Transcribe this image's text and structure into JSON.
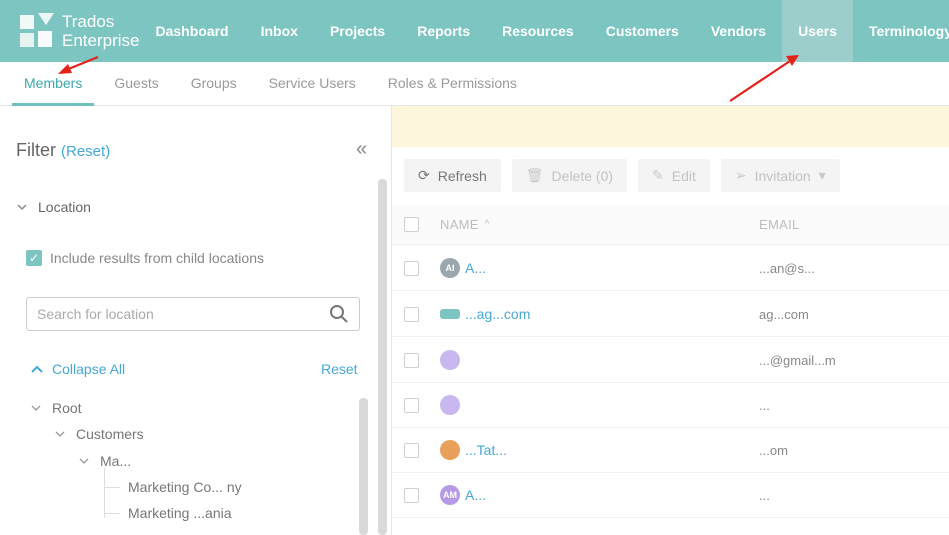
{
  "app": {
    "brand_line1": "Trados",
    "brand_line2": "Enterprise"
  },
  "nav": {
    "items": [
      {
        "label": "Dashboard"
      },
      {
        "label": "Inbox"
      },
      {
        "label": "Projects"
      },
      {
        "label": "Reports"
      },
      {
        "label": "Resources"
      },
      {
        "label": "Customers"
      },
      {
        "label": "Vendors"
      },
      {
        "label": "Users",
        "active": true
      },
      {
        "label": "Terminology"
      }
    ]
  },
  "subtabs": [
    {
      "label": "Members",
      "active": true
    },
    {
      "label": "Guests"
    },
    {
      "label": "Groups"
    },
    {
      "label": "Service Users"
    },
    {
      "label": "Roles & Permissions"
    }
  ],
  "filter": {
    "title": "Filter",
    "reset_label": "(Reset)",
    "collapse_icon": "double-chevron-left-icon",
    "location_label": "Location",
    "child_locations_label": "Include results from child locations",
    "child_locations_checked": true,
    "search_placeholder": "Search for location",
    "collapse_all_label": "Collapse All",
    "tree_reset_label": "Reset",
    "tree": {
      "root": "Root",
      "customers": "Customers",
      "group": "Ma...",
      "child1": "Marketing Co... ny",
      "child2": "Marketing ...ania"
    }
  },
  "toolbar": {
    "refresh": "Refresh",
    "delete": "Delete (0)",
    "edit": "Edit",
    "invitation": "Invitation"
  },
  "table": {
    "col_name": "NAME",
    "col_email": "EMAIL",
    "rows": [
      {
        "initials": "AI",
        "avatar_color": "#9aa7ad",
        "name": "A...",
        "email": "...an@s..."
      },
      {
        "initials": "",
        "avatar_color": "#7cc5c1",
        "name": "...ag...com",
        "email": "ag...com"
      },
      {
        "initials": "",
        "avatar_color": "#c9b8ef",
        "name": "",
        "email": "...@gmail...m"
      },
      {
        "initials": "",
        "avatar_color": "#c9b8ef",
        "name": "",
        "email": "..."
      },
      {
        "initials": "",
        "avatar_color": "#e8a05a",
        "name": "...Tat...",
        "email": "...om"
      },
      {
        "initials": "AM",
        "avatar_color": "#b79ae6",
        "name": "A...",
        "email": "..."
      }
    ]
  },
  "colors": {
    "topbar": "#7cc5c1",
    "accent": "#46a8d6",
    "annotation_arrow": "#e3231b"
  }
}
